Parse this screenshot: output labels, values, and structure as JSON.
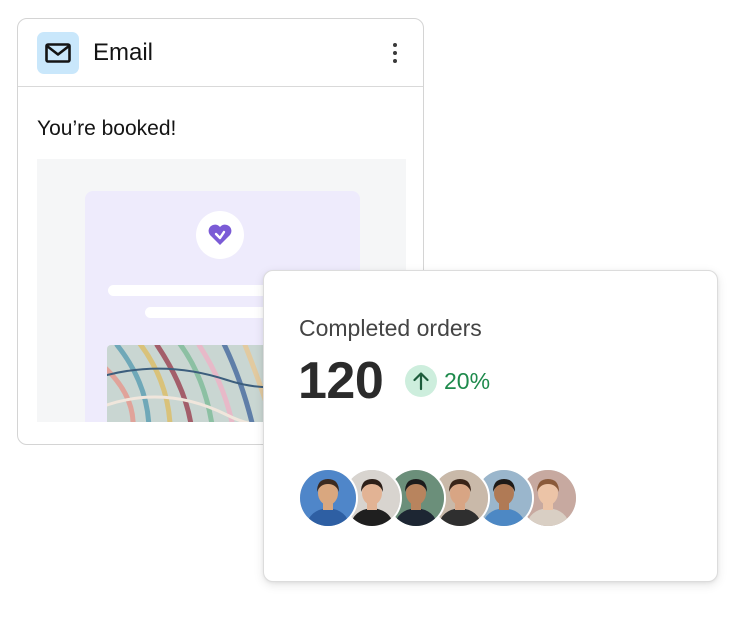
{
  "email_card": {
    "title": "Email",
    "icon": "mail-icon",
    "subject": "You’re booked!",
    "menu_icon": "more-vertical-icon",
    "colors": {
      "icon_bg": "#c9e7fb",
      "preview_bg": "#f5f6f7",
      "preview_panel": "#eeebfc",
      "logo": "#7b5bd6"
    }
  },
  "orders_card": {
    "label": "Completed orders",
    "value": "120",
    "change": "20%",
    "change_icon": "arrow-up-icon",
    "colors": {
      "change_text": "#1e8a4c",
      "change_bg": "#cdeedd"
    },
    "avatars": [
      {
        "name": "avatar-1",
        "bg": "#4f86c9",
        "skin": "#d9a77f",
        "hair": "#3b2a20",
        "shirt": "#2e5fa3"
      },
      {
        "name": "avatar-2",
        "bg": "#d8d4cf",
        "skin": "#e2b394",
        "hair": "#2d1f18",
        "shirt": "#1f1f1f"
      },
      {
        "name": "avatar-3",
        "bg": "#6b8f7a",
        "skin": "#b8845e",
        "hair": "#1c1c1c",
        "shirt": "#1d2633"
      },
      {
        "name": "avatar-4",
        "bg": "#c9b9a9",
        "skin": "#d8a584",
        "hair": "#3a2418",
        "shirt": "#2f2f2f"
      },
      {
        "name": "avatar-5",
        "bg": "#9ab6cc",
        "skin": "#b07a55",
        "hair": "#1e1a17",
        "shirt": "#4d88c4"
      },
      {
        "name": "avatar-6",
        "bg": "#c7a9a0",
        "skin": "#ecc4a7",
        "hair": "#8a5a3a",
        "shirt": "#d9cfc4"
      }
    ]
  }
}
